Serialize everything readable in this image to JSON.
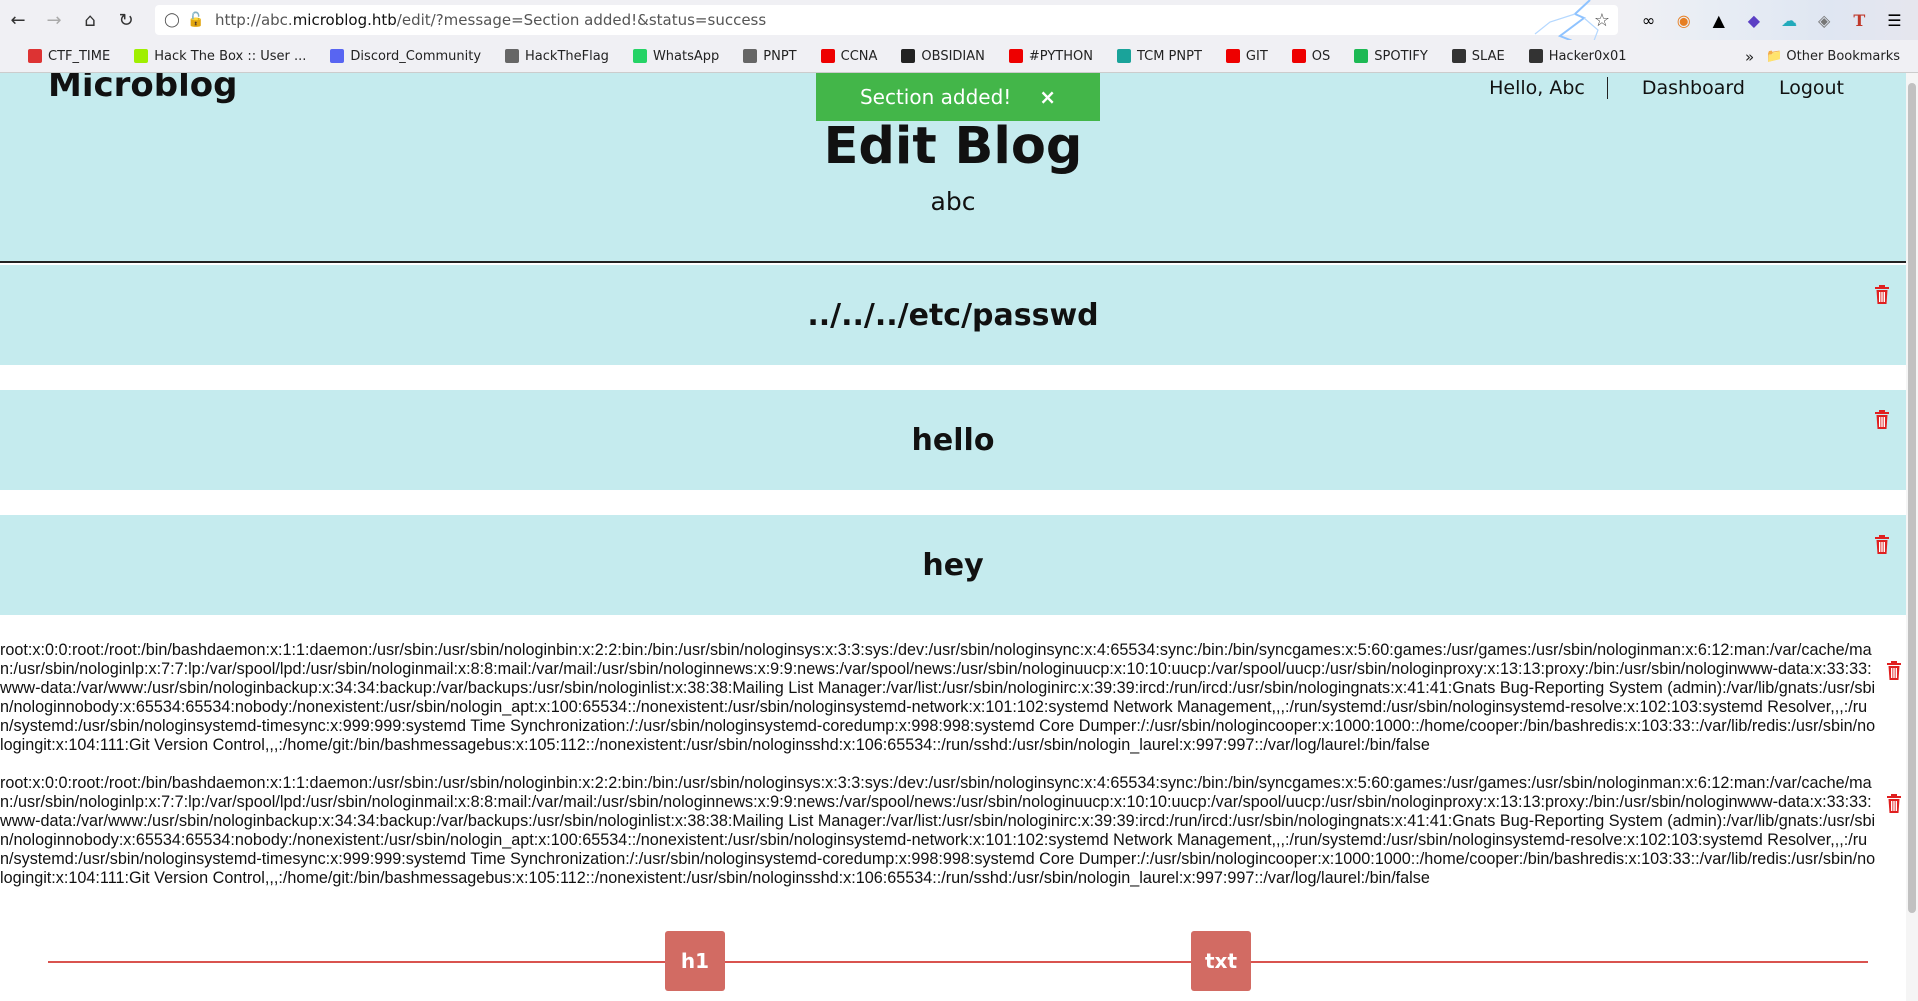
{
  "browser": {
    "url_prefix": "http://abc.",
    "url_domain": "microblog.htb",
    "url_suffix": "/edit/?message=Section added!&status=success",
    "bookmarks": [
      {
        "label": "CTF_TIME",
        "icon": "ctftime-icon",
        "color": "#d33"
      },
      {
        "label": "Hack The Box :: User ...",
        "icon": "htb-icon",
        "color": "#9fef00"
      },
      {
        "label": "Discord_Community",
        "icon": "discord-icon",
        "color": "#5865f2"
      },
      {
        "label": "HackTheFlag",
        "icon": "flag-icon",
        "color": "#666"
      },
      {
        "label": "WhatsApp",
        "icon": "whatsapp-icon",
        "color": "#25d366"
      },
      {
        "label": "PNPT",
        "icon": "folder-icon",
        "color": "#666"
      },
      {
        "label": "CCNA",
        "icon": "youtube-icon",
        "color": "#e00"
      },
      {
        "label": "OBSIDIAN",
        "icon": "github-icon",
        "color": "#222"
      },
      {
        "label": "#PYTHON",
        "icon": "youtube-icon",
        "color": "#e00"
      },
      {
        "label": "TCM PNPT",
        "icon": "tcm-icon",
        "color": "#1aa39a"
      },
      {
        "label": "GIT",
        "icon": "youtube-icon",
        "color": "#e00"
      },
      {
        "label": "OS",
        "icon": "youtube-icon",
        "color": "#e00"
      },
      {
        "label": "SPOTIFY",
        "icon": "spotify-icon",
        "color": "#1db954"
      },
      {
        "label": "SLAE",
        "icon": "slae-icon",
        "color": "#333"
      },
      {
        "label": "Hacker0x01",
        "icon": "hackerone-icon",
        "color": "#333"
      }
    ],
    "other_bookmarks": "Other Bookmarks"
  },
  "site": {
    "brand": "Microblog",
    "hello": "Hello, Abc",
    "dashboard": "Dashboard",
    "logout": "Logout",
    "toast": "Section added!",
    "toast_close": "×",
    "title": "Edit Blog",
    "subtitle": "abc"
  },
  "sections": [
    {
      "text": "../../../etc/passwd"
    },
    {
      "text": "hello"
    },
    {
      "text": "hey"
    }
  ],
  "txt_blocks": [
    "root:x:0:0:root:/root:/bin/bashdaemon:x:1:1:daemon:/usr/sbin:/usr/sbin/nologinbin:x:2:2:bin:/bin:/usr/sbin/nologinsys:x:3:3:sys:/dev:/usr/sbin/nologinsync:x:4:65534:sync:/bin:/bin/syncgames:x:5:60:games:/usr/games:/usr/sbin/nologinman:x:6:12:man:/var/cache/man:/usr/sbin/nologinlp:x:7:7:lp:/var/spool/lpd:/usr/sbin/nologinmail:x:8:8:mail:/var/mail:/usr/sbin/nologinnews:x:9:9:news:/var/spool/news:/usr/sbin/nologinuucp:x:10:10:uucp:/var/spool/uucp:/usr/sbin/nologinproxy:x:13:13:proxy:/bin:/usr/sbin/nologinwww-data:x:33:33:www-data:/var/www:/usr/sbin/nologinbackup:x:34:34:backup:/var/backups:/usr/sbin/nologinlist:x:38:38:Mailing List Manager:/var/list:/usr/sbin/nologinirc:x:39:39:ircd:/run/ircd:/usr/sbin/nologingnats:x:41:41:Gnats Bug-Reporting System (admin):/var/lib/gnats:/usr/sbin/nologinnobody:x:65534:65534:nobody:/nonexistent:/usr/sbin/nologin_apt:x:100:65534::/nonexistent:/usr/sbin/nologinsystemd-network:x:101:102:systemd Network Management,,,:/run/systemd:/usr/sbin/nologinsystemd-resolve:x:102:103:systemd Resolver,,,:/run/systemd:/usr/sbin/nologinsystemd-timesync:x:999:999:systemd Time Synchronization:/:/usr/sbin/nologinsystemd-coredump:x:998:998:systemd Core Dumper:/:/usr/sbin/nologincooper:x:1000:1000::/home/cooper:/bin/bashredis:x:103:33::/var/lib/redis:/usr/sbin/nologingit:x:104:111:Git Version Control,,,:/home/git:/bin/bashmessagebus:x:105:112::/nonexistent:/usr/sbin/nologinsshd:x:106:65534::/run/sshd:/usr/sbin/nologin_laurel:x:997:997::/var/log/laurel:/bin/false",
    "root:x:0:0:root:/root:/bin/bashdaemon:x:1:1:daemon:/usr/sbin:/usr/sbin/nologinbin:x:2:2:bin:/bin:/usr/sbin/nologinsys:x:3:3:sys:/dev:/usr/sbin/nologinsync:x:4:65534:sync:/bin:/bin/syncgames:x:5:60:games:/usr/games:/usr/sbin/nologinman:x:6:12:man:/var/cache/man:/usr/sbin/nologinlp:x:7:7:lp:/var/spool/lpd:/usr/sbin/nologinmail:x:8:8:mail:/var/mail:/usr/sbin/nologinnews:x:9:9:news:/var/spool/news:/usr/sbin/nologinuucp:x:10:10:uucp:/var/spool/uucp:/usr/sbin/nologinproxy:x:13:13:proxy:/bin:/usr/sbin/nologinwww-data:x:33:33:www-data:/var/www:/usr/sbin/nologinbackup:x:34:34:backup:/var/backups:/usr/sbin/nologinlist:x:38:38:Mailing List Manager:/var/list:/usr/sbin/nologinirc:x:39:39:ircd:/run/ircd:/usr/sbin/nologingnats:x:41:41:Gnats Bug-Reporting System (admin):/var/lib/gnats:/usr/sbin/nologinnobody:x:65534:65534:nobody:/nonexistent:/usr/sbin/nologin_apt:x:100:65534::/nonexistent:/usr/sbin/nologinsystemd-network:x:101:102:systemd Network Management,,,:/run/systemd:/usr/sbin/nologinsystemd-resolve:x:102:103:systemd Resolver,,,:/run/systemd:/usr/sbin/nologinsystemd-timesync:x:999:999:systemd Time Synchronization:/:/usr/sbin/nologinsystemd-coredump:x:998:998:systemd Core Dumper:/:/usr/sbin/nologincooper:x:1000:1000::/home/cooper:/bin/bashredis:x:103:33::/var/lib/redis:/usr/sbin/nologingit:x:104:111:Git Version Control,,,:/home/git:/bin/bashmessagebus:x:105:112::/nonexistent:/usr/sbin/nologinsshd:x:106:65534::/run/sshd:/usr/sbin/nologin_laurel:x:997:997::/var/log/laurel:/bin/false"
  ],
  "add_buttons": {
    "h1": "h1",
    "txt": "txt"
  },
  "colors": {
    "header_bg": "#c5ebee",
    "toast_bg": "#43b649",
    "trash": "#e02020",
    "add_btn": "#d26b63",
    "divider": "#d9534f"
  }
}
